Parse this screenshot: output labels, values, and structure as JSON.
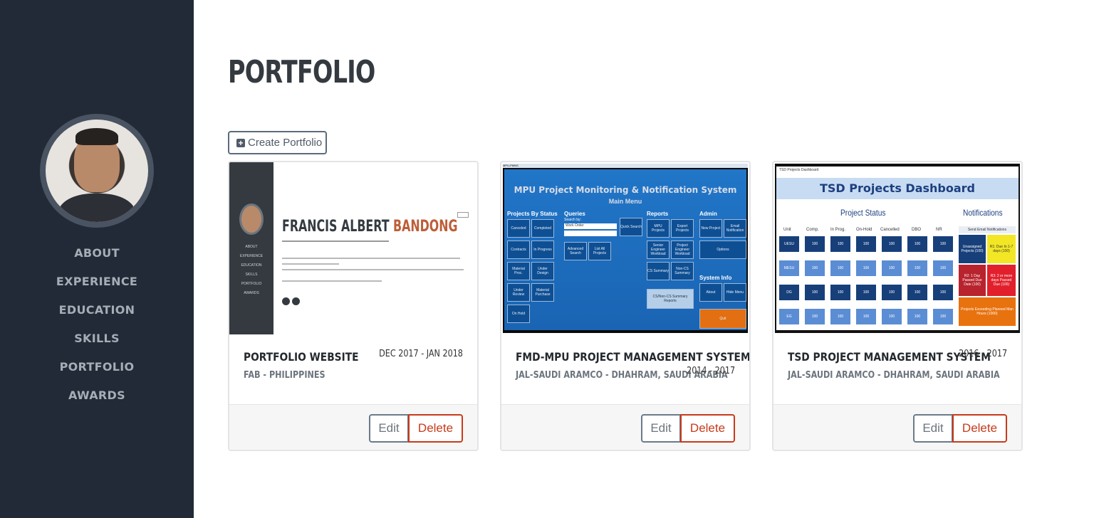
{
  "sidebar": {
    "nav": [
      "ABOUT",
      "EXPERIENCE",
      "EDUCATION",
      "SKILLS",
      "PORTFOLIO",
      "AWARDS"
    ]
  },
  "page_title": "PORTFOLIO",
  "create_button": "Create Portfolio",
  "cards": [
    {
      "title": "PORTFOLIO WEBSITE",
      "subtitle": "FAB - PHILIPPINES",
      "date": "DEC 2017 - JAN 2018",
      "edit": "Edit",
      "delete": "Delete",
      "preview": {
        "name_first": "FRANCIS ALBERT",
        "name_last": "BANDONG",
        "links": [
          "ABOUT",
          "EXPERIENCE",
          "EDUCATION",
          "SKILLS",
          "PORTFOLIO",
          "AWARDS"
        ]
      }
    },
    {
      "title": "FMD-MPU PROJECT MANAGEMENT SYSTEM",
      "subtitle": "JAL-SAUDI ARAMCO - DHAHRAM, SAUDI ARABIA",
      "date": "2014 - 2017",
      "edit": "Edit",
      "delete": "Delete",
      "preview": {
        "window_title": "MPU-PMNS",
        "heading": "MPU Project Monitoring & Notification System",
        "subheading": "Main Menu",
        "sections": [
          "Projects By Status",
          "Queries",
          "Reports",
          "Admin",
          "System Info"
        ],
        "status_tiles": [
          "Canceled",
          "Completed",
          "Contracts",
          "In Progress",
          "Material Proc.",
          "Under Design",
          "Under Review",
          "Material Purchase",
          "On Hold"
        ],
        "report_tiles": [
          "MPU Projects",
          "Export Projects",
          "Senior Engineer Workload",
          "Project Engineer Workload",
          "CS Summary",
          "Non-CS Summary",
          "CS/Non-CS Summary Reports"
        ],
        "admin_tiles": [
          "New Project",
          "Email Notification",
          "Options",
          "About",
          "Hide Menu",
          "Quit"
        ],
        "query_tiles": [
          "Quick Search",
          "Advanced Search",
          "List All Projects"
        ],
        "search_label": "Search by:",
        "search_value": "Work Order"
      }
    },
    {
      "title": "TSD PROJECT MANAGEMENT SYSTEM",
      "subtitle": "JAL-SAUDI ARAMCO - DHAHRAM, SAUDI ARABIA",
      "date": "2016 - 2017",
      "edit": "Edit",
      "delete": "Delete",
      "preview": {
        "window_title": "TSD Projects Dashboard",
        "heading": "TSD Projects Dashboard",
        "status_label": "Project Status",
        "notifications_label": "Notifications",
        "columns": [
          "Unit",
          "Comp.",
          "In Prog.",
          "On-Hold",
          "Cancelled",
          "DBO",
          "NR"
        ],
        "rows": [
          {
            "unit": "UESU",
            "values": [
              "100",
              "100",
              "100",
              "100",
              "100",
              "100"
            ]
          },
          {
            "unit": "MESU",
            "values": [
              "100",
              "100",
              "100",
              "100",
              "100",
              "100"
            ]
          },
          {
            "unit": "DG",
            "values": [
              "100",
              "100",
              "100",
              "100",
              "100",
              "100"
            ]
          },
          {
            "unit": "EG",
            "values": [
              "100",
              "100",
              "100",
              "100",
              "100",
              "100"
            ]
          }
        ],
        "send_email": "Send Email Notifications",
        "notes": [
          "Unassigned Projects (100)",
          "R1: Due In 1-7 days (100)",
          "R2: 1 Day Passed Due Date (100)",
          "R3: 2 or more days Passed Due (100)",
          "Projects Exceeding Planned Man Hours (1000)"
        ]
      }
    }
  ],
  "colors": {
    "sidebar_bg": "#212a36",
    "accent_orange": "#bd5d38",
    "delete_red": "#c83a1a"
  }
}
